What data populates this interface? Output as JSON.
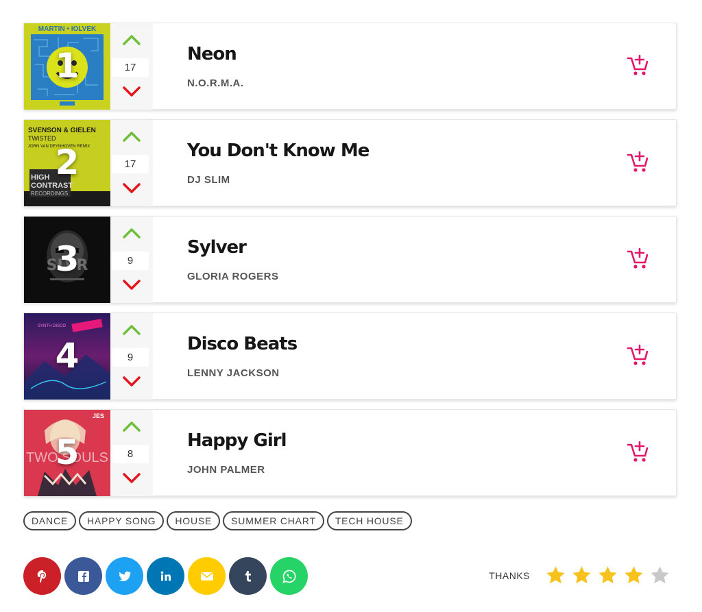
{
  "tracks": [
    {
      "rank": "1",
      "votes": "17",
      "title": "Neon",
      "artist": "N.O.R.M.A.",
      "cover_text": "MARTIN • IOLVEK"
    },
    {
      "rank": "2",
      "votes": "17",
      "title": "You Don't Know Me",
      "artist": "DJ SLIM",
      "cover_text": "SVENSON & GIELEN TWISTED JORN VAN DEYNHOVEN REMIX HIGH CONTRAST RECORDINGS"
    },
    {
      "rank": "3",
      "votes": "9",
      "title": "Sylver",
      "artist": "GLORIA ROGERS",
      "cover_text": ""
    },
    {
      "rank": "4",
      "votes": "9",
      "title": "Disco Beats",
      "artist": "LENNY JACKSON",
      "cover_text": ""
    },
    {
      "rank": "5",
      "votes": "8",
      "title": "Happy Girl",
      "artist": "JOHN PALMER",
      "cover_text": "JESS TWO SOULS"
    }
  ],
  "tags": [
    "DANCE",
    "HAPPY SONG",
    "HOUSE",
    "SUMMER CHART",
    "TECH HOUSE"
  ],
  "share": [
    {
      "name": "pinterest",
      "color": "#cb2027"
    },
    {
      "name": "facebook",
      "color": "#3b5998"
    },
    {
      "name": "twitter",
      "color": "#1da1f2"
    },
    {
      "name": "linkedin",
      "color": "#0077b5"
    },
    {
      "name": "email",
      "color": "#ffcc00"
    },
    {
      "name": "tumblr",
      "color": "#35465c"
    },
    {
      "name": "whatsapp",
      "color": "#25d366"
    }
  ],
  "rating": {
    "label": "THANKS",
    "value": 4,
    "max": 5
  },
  "colors": {
    "vote_up": "#6cc03a",
    "vote_down": "#e3161c",
    "cart": "#e5176a",
    "star_on": "#f7c21b",
    "star_off": "#c8c8c8"
  }
}
